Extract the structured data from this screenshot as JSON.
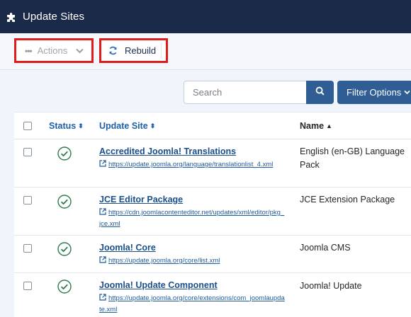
{
  "header": {
    "title": "Update Sites",
    "icon": "puzzle-icon"
  },
  "toolbar": {
    "actions_label": "Actions",
    "rebuild_label": "Rebuild"
  },
  "search": {
    "placeholder": "Search",
    "filter_label": "Filter Options"
  },
  "table": {
    "columns": {
      "status": "Status",
      "update_site": "Update Site",
      "name": "Name"
    },
    "rows": [
      {
        "site": "Accredited Joomla! Translations",
        "url": "https://update.joomla.org/language/translationlist_4.xml",
        "name": "English (en-GB) Language Pack",
        "status": "enabled"
      },
      {
        "site": "JCE Editor Package",
        "url": "https://cdn.joomlacontenteditor.net/updates/xml/editor/pkg_jce.xml",
        "name": "JCE Extension Package",
        "status": "enabled"
      },
      {
        "site": "Joomla! Core",
        "url": "https://update.joomla.org/core/list.xml",
        "name": "Joomla CMS",
        "status": "enabled"
      },
      {
        "site": "Joomla! Update Component",
        "url": "https://update.joomla.org/core/extensions/com_joomlaupdate.xml",
        "name": "Joomla! Update",
        "status": "enabled"
      }
    ]
  },
  "colors": {
    "header_bg": "#1c2a49",
    "primary": "#2f5d94",
    "success": "#2e7d4f",
    "highlight": "#e01b1b"
  }
}
